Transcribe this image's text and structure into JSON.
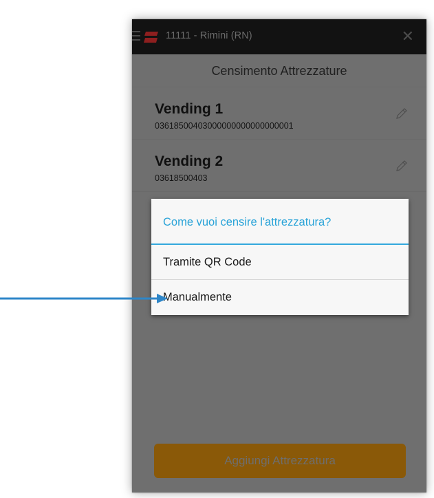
{
  "topbar": {
    "title": "11111 - Rimini (RN)",
    "menu_icon": "hamburger-icon",
    "logo_icon": "app-logo",
    "close_icon": "close-icon",
    "close_glyph": "✕"
  },
  "header": {
    "title": "Censimento Attrezzature"
  },
  "items": [
    {
      "name": "Vending 1",
      "code": "03618500403000000000000000001",
      "edit_icon": "pencil-icon"
    },
    {
      "name": "Vending 2",
      "code": "03618500403",
      "edit_icon": "pencil-icon"
    }
  ],
  "dialog": {
    "title": "Come vuoi censire l'attrezzatura?",
    "options": [
      "Tramite QR Code",
      "Manualmente"
    ]
  },
  "footer": {
    "add_button": "Aggiungi Attrezzatura"
  },
  "colors": {
    "accent": "#33a8dd",
    "button": "#8a5908",
    "arrow": "#2e86c8",
    "overlay": "#6f6f6f"
  }
}
